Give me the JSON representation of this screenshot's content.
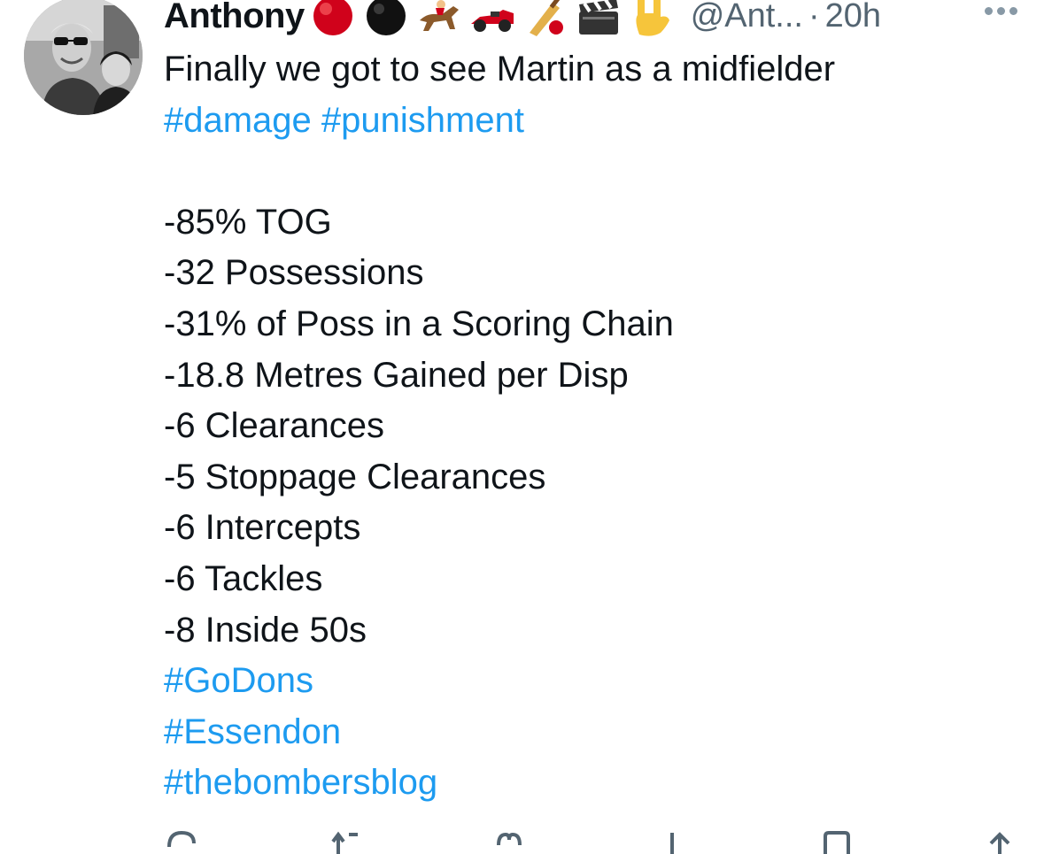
{
  "tweet": {
    "author": {
      "display_name": "Anthony",
      "emoji_icons": [
        "red-circle-icon",
        "black-circle-icon",
        "horse-racing-icon",
        "racing-car-icon",
        "cricket-icon",
        "clapper-board-icon",
        "rock-on-hand-icon"
      ],
      "handle": "@Ant...",
      "separator": "·",
      "time": "20h"
    },
    "text_lines": [
      "Finally we got to see Martin as a midfielder"
    ],
    "hashtags_line1": [
      "#damage",
      "#punishment"
    ],
    "stats": [
      "-85% TOG",
      "-32 Possessions",
      "-31% of Poss in a Scoring Chain",
      "-18.8 Metres Gained per Disp",
      "-6 Clearances",
      "-5 Stoppage Clearances",
      "-6 Intercepts",
      "-6 Tackles",
      "-8 Inside 50s"
    ],
    "hashtags_footer": [
      "#GoDons",
      "#Essendon",
      "#thebombersblog"
    ],
    "actions": [
      "reply-icon",
      "retweet-icon",
      "like-icon",
      "views-icon",
      "bookmark-icon",
      "share-icon"
    ]
  },
  "colors": {
    "link": "#1d9bf0",
    "text": "#0f1419",
    "muted": "#536471"
  }
}
